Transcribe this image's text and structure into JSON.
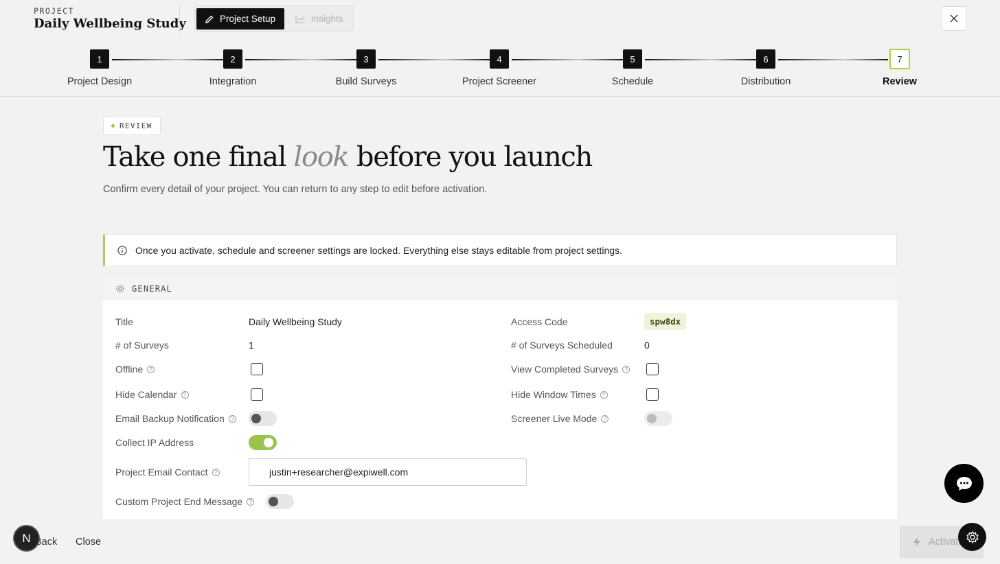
{
  "header": {
    "kicker": "PROJECT",
    "project_title": "Daily Wellbeing Study",
    "tabs": [
      {
        "label": "Project Setup",
        "active": true,
        "icon": "pencil-icon"
      },
      {
        "label": "Insights",
        "active": false,
        "icon": "chart-icon"
      }
    ]
  },
  "stepper": {
    "current": 7,
    "steps": [
      {
        "number": "1",
        "label": "Project Design"
      },
      {
        "number": "2",
        "label": "Integration"
      },
      {
        "number": "3",
        "label": "Build Surveys"
      },
      {
        "number": "4",
        "label": "Project Screener"
      },
      {
        "number": "5",
        "label": "Schedule"
      },
      {
        "number": "6",
        "label": "Distribution"
      },
      {
        "number": "7",
        "label": "Review"
      }
    ]
  },
  "main": {
    "badge": "REVIEW",
    "headline_pre": "Take one final",
    "headline_em": "look",
    "headline_post": "before you launch",
    "subtitle": "Confirm every detail of your project. You can return to any step to edit before activation.",
    "notice": "Once you activate, schedule and screener settings are locked. Everything else stays editable from project settings."
  },
  "general": {
    "heading": "GENERAL",
    "title_label": "Title",
    "title_value": "Daily Wellbeing Study",
    "access_code_label": "Access Code",
    "access_code_value": "spw8dx",
    "surveys_label": "# of Surveys",
    "surveys_value": "1",
    "scheduled_label": "# of Surveys Scheduled",
    "scheduled_value": "0",
    "offline_label": "Offline",
    "offline_checked": false,
    "view_completed_label": "View Completed Surveys",
    "view_completed_checked": false,
    "hide_calendar_label": "Hide Calendar",
    "hide_calendar_checked": false,
    "hide_window_label": "Hide Window Times",
    "hide_window_checked": false,
    "email_backup_label": "Email Backup Notification",
    "email_backup_on": false,
    "screener_live_label": "Screener Live Mode",
    "screener_live_on": false,
    "collect_ip_label": "Collect IP Address",
    "collect_ip_on": true,
    "email_contact_label": "Project Email Contact",
    "email_contact_value": "justin+researcher@expiwell.com",
    "custom_end_label": "Custom Project End Message",
    "custom_end_on": false
  },
  "footer": {
    "back_label": "Back",
    "close_label": "Close",
    "activate_label": "Activate"
  },
  "avatar_initial": "N",
  "colors": {
    "accent": "#9bc44c",
    "dark": "#111111"
  }
}
